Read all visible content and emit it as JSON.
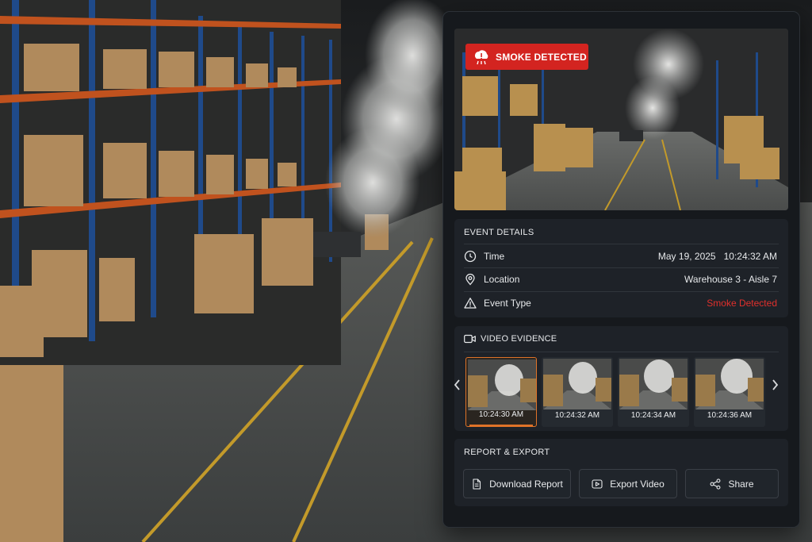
{
  "alert": {
    "label": "SMOKE DETECTED",
    "icon": "smoke-alarm-icon",
    "color": "#d32420"
  },
  "event_details": {
    "title": "EVENT DETAILS",
    "rows": [
      {
        "icon": "clock-icon",
        "label": "Time",
        "date": "May 19, 2025",
        "time": "10:24:32 AM"
      },
      {
        "icon": "location-pin-icon",
        "label": "Location",
        "value": "Warehouse 3 - Aisle 7"
      },
      {
        "icon": "warning-triangle-icon",
        "label": "Event Type",
        "value": "Smoke Detected",
        "value_color": "#e1302c"
      }
    ]
  },
  "video_evidence": {
    "title": "VIDEO EVIDENCE",
    "icon": "video-camera-icon",
    "selected_index": 0,
    "thumbnails": [
      {
        "time": "10:24:30 AM"
      },
      {
        "time": "10:24:32 AM"
      },
      {
        "time": "10:24:34 AM"
      },
      {
        "time": "10:24:36 AM"
      }
    ],
    "accent_color": "#e07328"
  },
  "report_export": {
    "title": "REPORT & EXPORT",
    "buttons": [
      {
        "label": "Download Report",
        "icon": "document-icon"
      },
      {
        "label": "Export Video",
        "icon": "play-icon"
      },
      {
        "label": "Share",
        "icon": "share-icon"
      }
    ]
  }
}
